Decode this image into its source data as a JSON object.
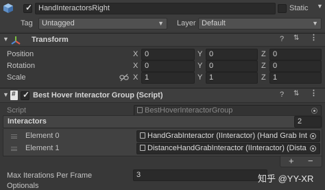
{
  "header": {
    "object_name": "HandInteractorsRight",
    "active_checked": true,
    "static_label": "Static",
    "static_checked": false,
    "tag_label": "Tag",
    "tag_value": "Untagged",
    "layer_label": "Layer",
    "layer_value": "Default"
  },
  "transform": {
    "title": "Transform",
    "rows": [
      {
        "label": "Position",
        "x": "0",
        "y": "0",
        "z": "0"
      },
      {
        "label": "Rotation",
        "x": "0",
        "y": "0",
        "z": "0"
      },
      {
        "label": "Scale",
        "x": "1",
        "y": "1",
        "z": "1"
      }
    ],
    "axis_x": "X",
    "axis_y": "Y",
    "axis_z": "Z"
  },
  "script_component": {
    "title": "Best Hover Interactor Group (Script)",
    "enabled_checked": true,
    "script_label": "Script",
    "script_value": "BestHoverInteractorGroup",
    "interactors_label": "Interactors",
    "interactors_count": "2",
    "elements": [
      {
        "label": "Element 0",
        "value": "HandGrabInteractor (IInteractor) (Hand Grab Int"
      },
      {
        "label": "Element 1",
        "value": "DistanceHandGrabInteractor (IInteractor) (Dista"
      }
    ],
    "add_glyph": "+",
    "remove_glyph": "−",
    "max_iterations_label": "Max Iterations Per Frame",
    "max_iterations_value": "3",
    "optionals_label": "Optionals"
  },
  "watermark": "知乎 @YY-XR"
}
